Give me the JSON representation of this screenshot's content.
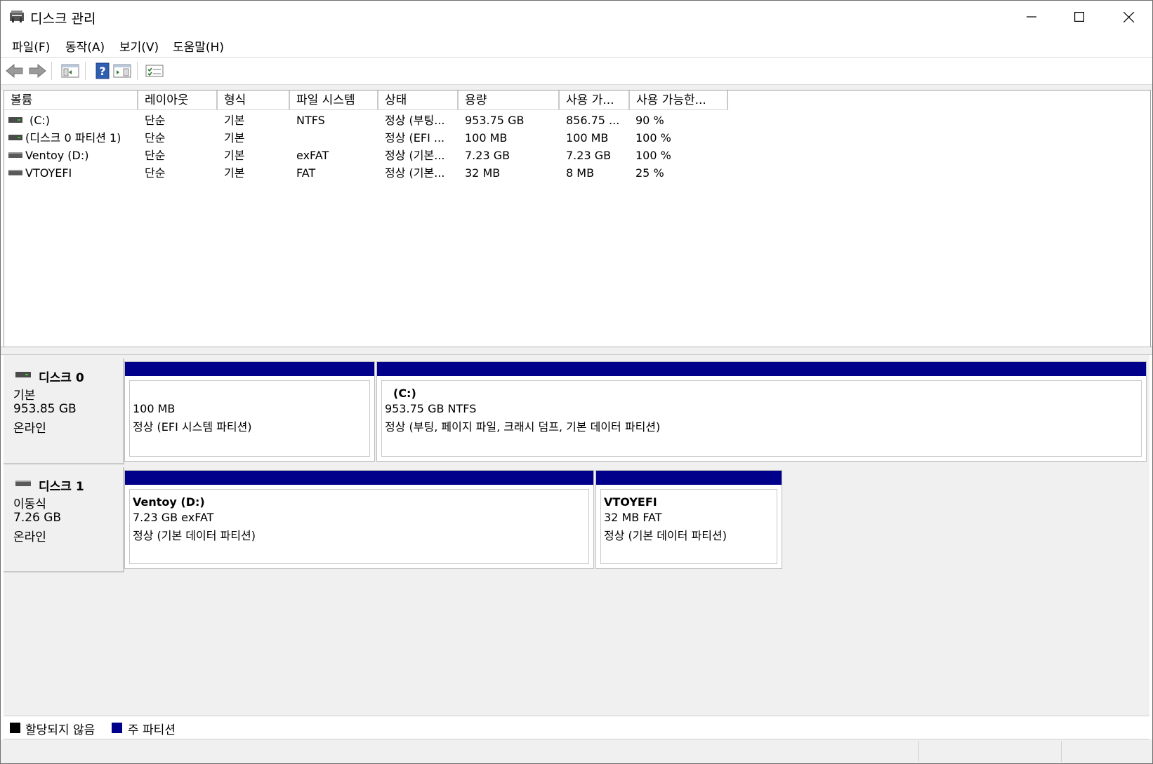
{
  "window": {
    "title": "디스크 관리"
  },
  "menu": [
    "파일(F)",
    "동작(A)",
    "보기(V)",
    "도움말(H)"
  ],
  "toolbar": {
    "icons": [
      "back-arrow-icon",
      "forward-arrow-icon",
      "console-tree-icon",
      "help-icon",
      "show-pane-icon",
      "properties-icon"
    ]
  },
  "volume_list": {
    "columns": [
      "볼륨",
      "레이아웃",
      "형식",
      "파일 시스템",
      "상태",
      "용량",
      "사용 가...",
      "사용 가능한..."
    ],
    "rows": [
      [
        "(C:)",
        "단순",
        "기본",
        "NTFS",
        "정상 (부팅...",
        "953.75 GB",
        "856.75 ...",
        "90 %"
      ],
      [
        "(디스크 0 파티션 1)",
        "단순",
        "기본",
        "",
        "정상 (EFI ...",
        "100 MB",
        "100 MB",
        "100 %"
      ],
      [
        "Ventoy (D:)",
        "단순",
        "기본",
        "exFAT",
        "정상 (기본...",
        "7.23 GB",
        "7.23 GB",
        "100 %"
      ],
      [
        "VTOYEFI",
        "단순",
        "기본",
        "FAT",
        "정상 (기본...",
        "32 MB",
        "8 MB",
        "25 %"
      ]
    ]
  },
  "disks": [
    {
      "name": "디스크 0",
      "type": "기본",
      "size": "953.85 GB",
      "status": "온라인",
      "partitions": [
        {
          "name": "",
          "size": "100 MB",
          "status": "정상 (EFI 시스템 파티션)"
        },
        {
          "name": "(C:)",
          "size": "953.75 GB NTFS",
          "status": "정상 (부팅, 페이지 파일, 크래시 덤프, 기본 데이터 파티션)"
        }
      ]
    },
    {
      "name": "디스크 1",
      "type": "이동식",
      "size": "7.26 GB",
      "status": "온라인",
      "partitions": [
        {
          "name": "Ventoy  (D:)",
          "size": "7.23 GB exFAT",
          "status": "정상 (기본 데이터 파티션)"
        },
        {
          "name": "VTOYEFI",
          "size": "32 MB FAT",
          "status": "정상 (기본 데이터 파티션)"
        }
      ]
    }
  ],
  "legend": [
    {
      "label": "할당되지 않음",
      "color": "#000000"
    },
    {
      "label": "주 파티션",
      "color": "#00008b"
    }
  ],
  "colors": {
    "primary_partition": "#00008b",
    "unallocated": "#000000"
  }
}
